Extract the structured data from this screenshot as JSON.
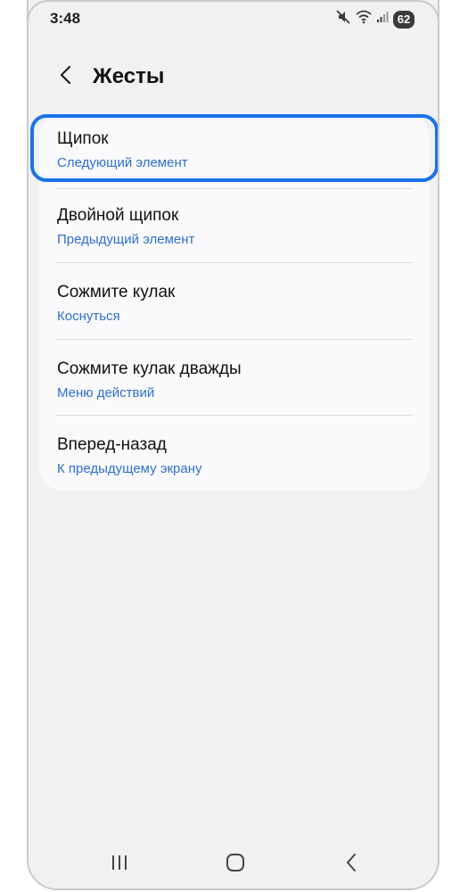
{
  "status_bar": {
    "time": "3:48",
    "battery": "62",
    "icons": [
      "mute-icon",
      "wifi-icon",
      "signal-icon",
      "battery-icon"
    ]
  },
  "header": {
    "title": "Жесты",
    "back_icon": "chevron-left-icon"
  },
  "gestures": [
    {
      "title": "Щипок",
      "action": "Следующий элемент",
      "selected": true
    },
    {
      "title": "Двойной щипок",
      "action": "Предыдущий элемент"
    },
    {
      "title": "Сожмите кулак",
      "action": "Коснуться"
    },
    {
      "title": "Сожмите кулак дважды",
      "action": "Меню действий"
    },
    {
      "title": "Вперед-назад",
      "action": "К предыдущему экрану"
    }
  ],
  "nav_bar": {
    "icons": [
      "recents-icon",
      "home-icon",
      "back-icon"
    ]
  },
  "colors": {
    "accent": "#2f6ed0",
    "focus": "#1a73e8",
    "background": "#f1f1f4",
    "card": "#fafafd"
  }
}
